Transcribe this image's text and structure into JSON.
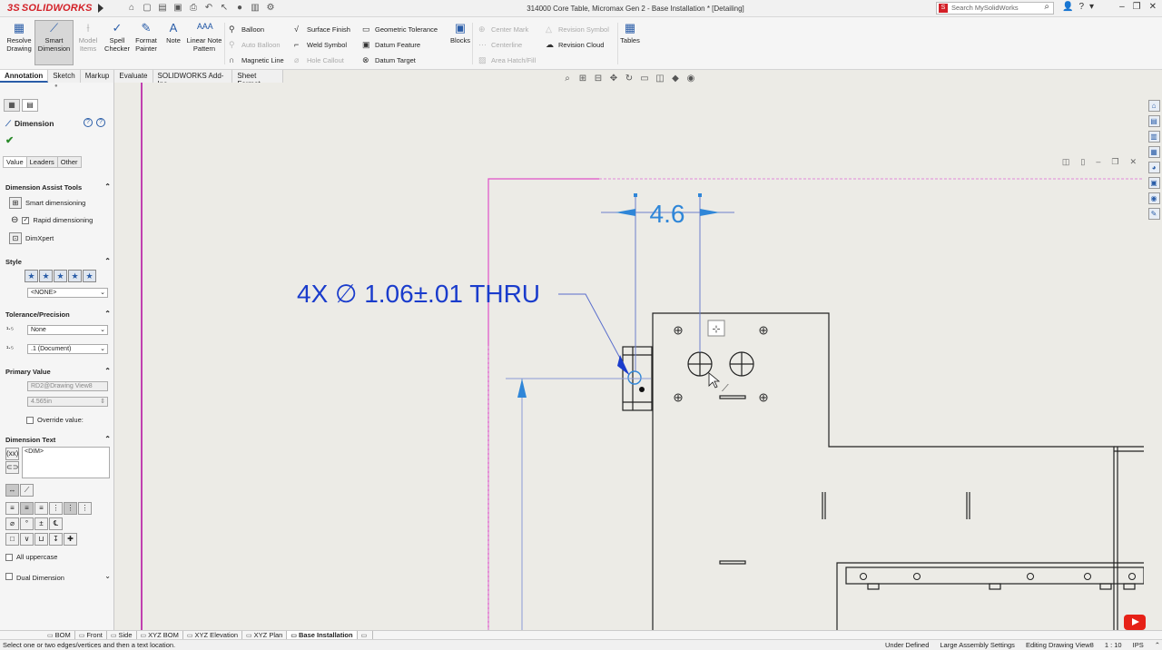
{
  "app": {
    "logo_text": "SOLIDWORKS",
    "window_title": "314000 Core Table, Micromax Gen 2 - Base Installation * [Detailing]",
    "search_placeholder": "Search MySolidWorks"
  },
  "ribbon": {
    "resolve_drawing": "Resolve Drawing",
    "smart_dimension": "Smart Dimension",
    "model_items": "Model Items",
    "spell_checker": "Spell Checker",
    "format_painter": "Format Painter",
    "note": "Note",
    "linear_note_pattern": "Linear Note Pattern",
    "balloon": "Balloon",
    "auto_balloon": "Auto Balloon",
    "magnetic_line": "Magnetic Line",
    "surface_finish": "Surface Finish",
    "weld_symbol": "Weld Symbol",
    "hole_callout": "Hole Callout",
    "geometric_tolerance": "Geometric Tolerance",
    "datum_feature": "Datum Feature",
    "datum_target": "Datum Target",
    "blocks": "Blocks",
    "center_mark": "Center Mark",
    "centerline": "Centerline",
    "area_hatch": "Area Hatch/Fill",
    "revision_symbol": "Revision Symbol",
    "revision_cloud": "Revision Cloud",
    "tables": "Tables"
  },
  "tabs": [
    "Annotation",
    "Sketch",
    "Markup",
    "Evaluate",
    "SOLIDWORKS Add-Ins",
    "Sheet Format"
  ],
  "panel": {
    "title": "Dimension",
    "subtabs": [
      "Value",
      "Leaders",
      "Other"
    ],
    "assist_header": "Dimension Assist Tools",
    "smart_dimensioning": "Smart dimensioning",
    "rapid_dimensioning": "Rapid dimensioning",
    "dimxpert": "DimXpert",
    "style_header": "Style",
    "style_value": "<NONE>",
    "tolerance_header": "Tolerance/Precision",
    "tolerance_value": "None",
    "precision_value": ".1 (Document)",
    "primary_header": "Primary Value",
    "primary_name": "RD2@Drawing View8",
    "primary_value": "4.565in",
    "override_label": "Override value:",
    "dimtext_header": "Dimension Text",
    "dimtext_value": "<DIM>",
    "all_uppercase": "All uppercase",
    "dual_dimension": "Dual Dimension"
  },
  "drawing": {
    "dimension_value": "4.6",
    "hole_callout": "4X ∅ 1.06±.01 THRU"
  },
  "sheets": [
    "BOM",
    "Front",
    "Side",
    "XYZ BOM",
    "XYZ Elevation",
    "XYZ Plan",
    "Base Installation"
  ],
  "status": {
    "message": "Select one or two edges/vertices and then a text location.",
    "under_defined": "Under Defined",
    "large_assembly": "Large Assembly Settings",
    "editing": "Editing Drawing View8",
    "scale": "1 : 10",
    "units": "IPS"
  },
  "colors": {
    "brand": "#d32027",
    "annotation_blue": "#1a3ccc",
    "selected_blue": "#2f86d8",
    "sheet_pink": "#d040c0"
  }
}
